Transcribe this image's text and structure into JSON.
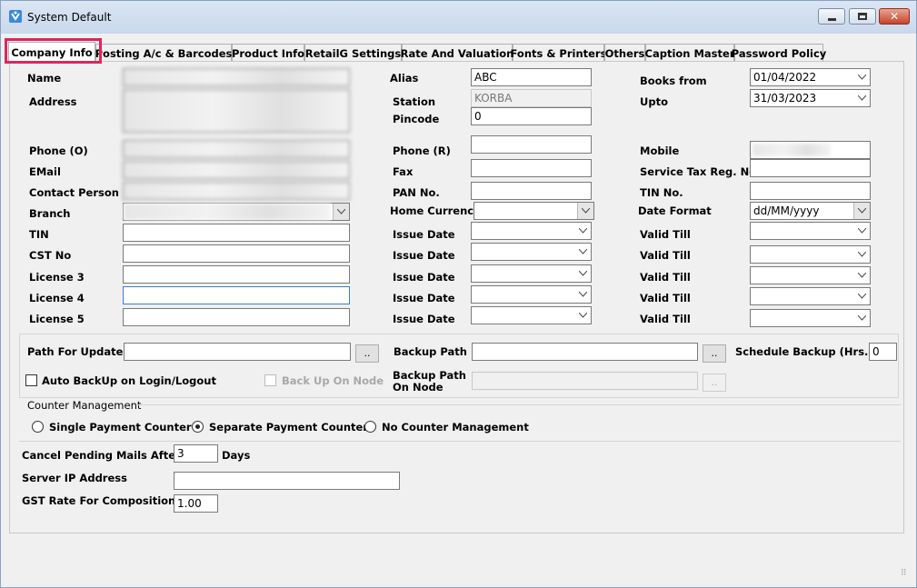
{
  "window": {
    "title": "System Default"
  },
  "tabs": [
    {
      "label": "Company Info",
      "active": true
    },
    {
      "label": "Posting A/c & Barcodes"
    },
    {
      "label": "Product Info"
    },
    {
      "label": "RetailG Settings"
    },
    {
      "label": "Rate And Valuation"
    },
    {
      "label": "Fonts & Printers"
    },
    {
      "label": "Others"
    },
    {
      "label": "Caption Master"
    },
    {
      "label": "Password Policy"
    }
  ],
  "company": {
    "name_label": "Name",
    "address_label": "Address",
    "phone_o_label": "Phone (O)",
    "email_label": "EMail",
    "contact_label": "Contact Person",
    "branch_label": "Branch",
    "tin_label": "TIN",
    "cst_label": "CST No",
    "license3_label": "License 3",
    "license4_label": "License 4",
    "license5_label": "License 5"
  },
  "middle": {
    "alias_label": "Alias",
    "alias_value": "ABC",
    "station_label": "Station",
    "station_value": "KORBA",
    "pincode_label": "Pincode",
    "pincode_value": "0",
    "phone_r_label": "Phone (R)",
    "fax_label": "Fax",
    "pan_label": "PAN No.",
    "currency_label": "Home Currency",
    "issue_date_label": "Issue Date"
  },
  "right": {
    "books_from_label": "Books from",
    "books_from_value": "01/04/2022",
    "upto_label": "Upto",
    "upto_value": "31/03/2023",
    "mobile_label": "Mobile",
    "stax_label": "Service Tax Reg. No",
    "tin_no_label": "TIN No.",
    "date_format_label": "Date Format",
    "date_format_value": "dd/MM/yyyy",
    "valid_till_label": "Valid Till"
  },
  "backup": {
    "path_update_label": "Path For Update",
    "backup_path_label": "Backup Path",
    "schedule_label": "Schedule Backup (Hrs.)",
    "schedule_value": "0",
    "auto_backup_label": "Auto BackUp on Login/Logout",
    "backup_node_label": "Back Up On Node",
    "backup_path_node_label_1": "Backup Path",
    "backup_path_node_label_2": "On Node",
    "browse_label": ".."
  },
  "counter": {
    "group_label": "Counter Management",
    "options": [
      "Single Payment Counter",
      "Separate Payment Counter",
      "No Counter Management"
    ],
    "selected": "Separate Payment Counter"
  },
  "misc": {
    "cancel_mails_label": "Cancel Pending Mails After",
    "cancel_mails_value": "3",
    "days_label": "Days",
    "server_ip_label": "Server IP Address",
    "gst_label": "GST Rate For Composition",
    "gst_value": "1.00"
  }
}
